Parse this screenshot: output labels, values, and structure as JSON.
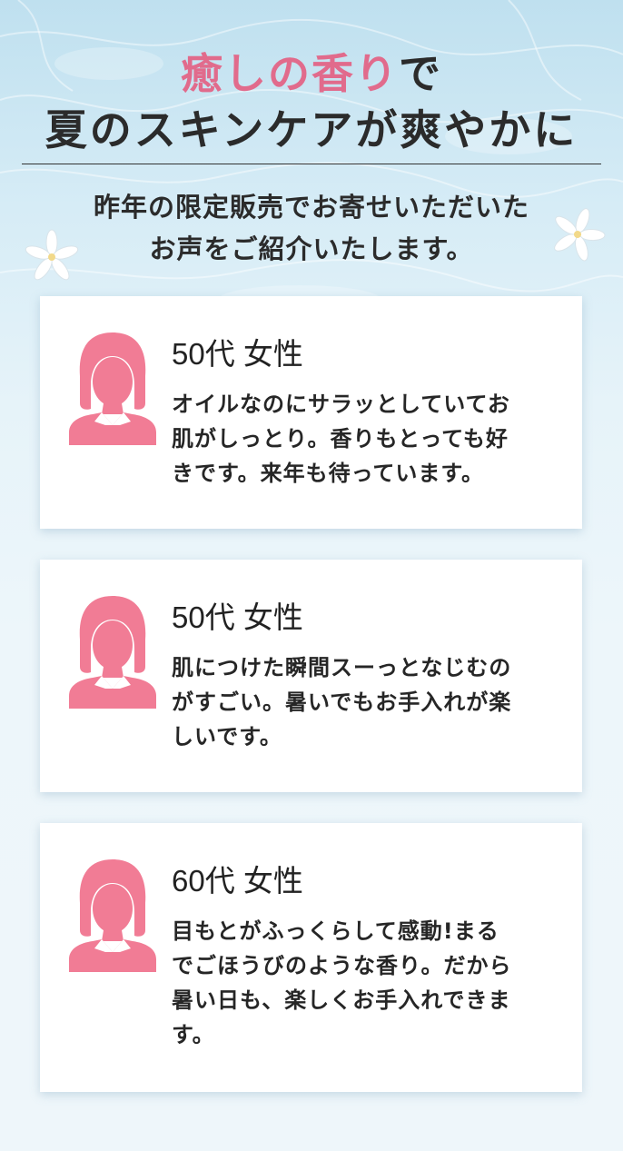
{
  "header": {
    "title_line1_accent": "癒しの香り",
    "title_line1_rest": "で",
    "title_line2": "夏のスキンケアが爽やかに",
    "intro_line1": "昨年の限定販売でお寄せいただいた",
    "intro_line2": "お声をご紹介いたします。"
  },
  "colors": {
    "accent": "#e16b8c",
    "avatar": "#f17c95",
    "text": "#2b2b2b"
  },
  "reviews": [
    {
      "who": "50代 女性",
      "lines": [
        "オイルなのにサラッとしていてお",
        "肌がしっとり。香りもとっても好",
        "きです。来年も待っています。"
      ],
      "icon": "woman-avatar-icon"
    },
    {
      "who": "50代 女性",
      "lines": [
        "肌につけた瞬間スーっとなじむの",
        "がすごい。暑いでもお手入れが楽",
        "しいです。"
      ],
      "icon": "woman-avatar-icon"
    },
    {
      "who": "60代 女性",
      "lines": [
        "目もとがふっくらして感動!まる",
        "でごほうびのような香り。だから",
        "暑い日も、楽しくお手入れできま",
        "す。"
      ],
      "icon": "woman-avatar-icon"
    }
  ]
}
